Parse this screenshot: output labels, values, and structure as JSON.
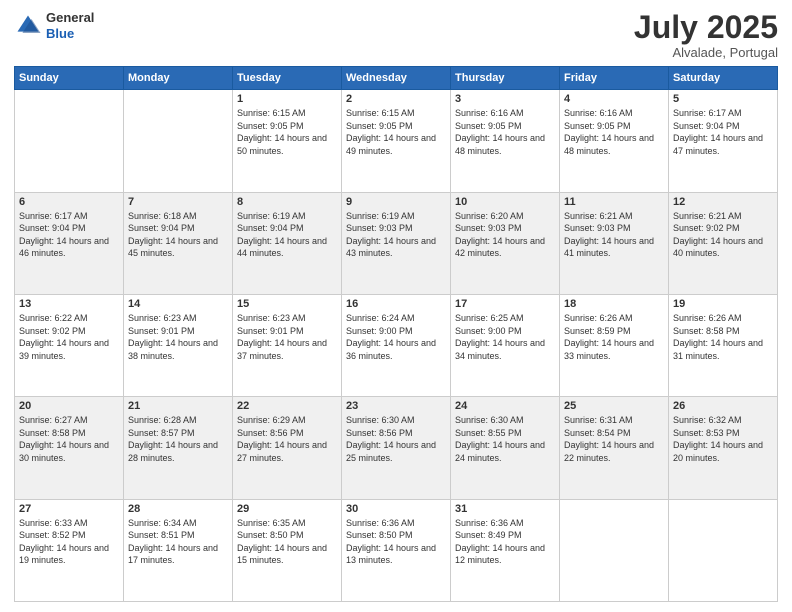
{
  "header": {
    "logo_line1": "General",
    "logo_line2": "Blue",
    "month": "July 2025",
    "location": "Alvalade, Portugal"
  },
  "weekdays": [
    "Sunday",
    "Monday",
    "Tuesday",
    "Wednesday",
    "Thursday",
    "Friday",
    "Saturday"
  ],
  "weeks": [
    [
      {
        "day": "",
        "info": ""
      },
      {
        "day": "",
        "info": ""
      },
      {
        "day": "1",
        "info": "Sunrise: 6:15 AM\nSunset: 9:05 PM\nDaylight: 14 hours and 50 minutes."
      },
      {
        "day": "2",
        "info": "Sunrise: 6:15 AM\nSunset: 9:05 PM\nDaylight: 14 hours and 49 minutes."
      },
      {
        "day": "3",
        "info": "Sunrise: 6:16 AM\nSunset: 9:05 PM\nDaylight: 14 hours and 48 minutes."
      },
      {
        "day": "4",
        "info": "Sunrise: 6:16 AM\nSunset: 9:05 PM\nDaylight: 14 hours and 48 minutes."
      },
      {
        "day": "5",
        "info": "Sunrise: 6:17 AM\nSunset: 9:04 PM\nDaylight: 14 hours and 47 minutes."
      }
    ],
    [
      {
        "day": "6",
        "info": "Sunrise: 6:17 AM\nSunset: 9:04 PM\nDaylight: 14 hours and 46 minutes."
      },
      {
        "day": "7",
        "info": "Sunrise: 6:18 AM\nSunset: 9:04 PM\nDaylight: 14 hours and 45 minutes."
      },
      {
        "day": "8",
        "info": "Sunrise: 6:19 AM\nSunset: 9:04 PM\nDaylight: 14 hours and 44 minutes."
      },
      {
        "day": "9",
        "info": "Sunrise: 6:19 AM\nSunset: 9:03 PM\nDaylight: 14 hours and 43 minutes."
      },
      {
        "day": "10",
        "info": "Sunrise: 6:20 AM\nSunset: 9:03 PM\nDaylight: 14 hours and 42 minutes."
      },
      {
        "day": "11",
        "info": "Sunrise: 6:21 AM\nSunset: 9:03 PM\nDaylight: 14 hours and 41 minutes."
      },
      {
        "day": "12",
        "info": "Sunrise: 6:21 AM\nSunset: 9:02 PM\nDaylight: 14 hours and 40 minutes."
      }
    ],
    [
      {
        "day": "13",
        "info": "Sunrise: 6:22 AM\nSunset: 9:02 PM\nDaylight: 14 hours and 39 minutes."
      },
      {
        "day": "14",
        "info": "Sunrise: 6:23 AM\nSunset: 9:01 PM\nDaylight: 14 hours and 38 minutes."
      },
      {
        "day": "15",
        "info": "Sunrise: 6:23 AM\nSunset: 9:01 PM\nDaylight: 14 hours and 37 minutes."
      },
      {
        "day": "16",
        "info": "Sunrise: 6:24 AM\nSunset: 9:00 PM\nDaylight: 14 hours and 36 minutes."
      },
      {
        "day": "17",
        "info": "Sunrise: 6:25 AM\nSunset: 9:00 PM\nDaylight: 14 hours and 34 minutes."
      },
      {
        "day": "18",
        "info": "Sunrise: 6:26 AM\nSunset: 8:59 PM\nDaylight: 14 hours and 33 minutes."
      },
      {
        "day": "19",
        "info": "Sunrise: 6:26 AM\nSunset: 8:58 PM\nDaylight: 14 hours and 31 minutes."
      }
    ],
    [
      {
        "day": "20",
        "info": "Sunrise: 6:27 AM\nSunset: 8:58 PM\nDaylight: 14 hours and 30 minutes."
      },
      {
        "day": "21",
        "info": "Sunrise: 6:28 AM\nSunset: 8:57 PM\nDaylight: 14 hours and 28 minutes."
      },
      {
        "day": "22",
        "info": "Sunrise: 6:29 AM\nSunset: 8:56 PM\nDaylight: 14 hours and 27 minutes."
      },
      {
        "day": "23",
        "info": "Sunrise: 6:30 AM\nSunset: 8:56 PM\nDaylight: 14 hours and 25 minutes."
      },
      {
        "day": "24",
        "info": "Sunrise: 6:30 AM\nSunset: 8:55 PM\nDaylight: 14 hours and 24 minutes."
      },
      {
        "day": "25",
        "info": "Sunrise: 6:31 AM\nSunset: 8:54 PM\nDaylight: 14 hours and 22 minutes."
      },
      {
        "day": "26",
        "info": "Sunrise: 6:32 AM\nSunset: 8:53 PM\nDaylight: 14 hours and 20 minutes."
      }
    ],
    [
      {
        "day": "27",
        "info": "Sunrise: 6:33 AM\nSunset: 8:52 PM\nDaylight: 14 hours and 19 minutes."
      },
      {
        "day": "28",
        "info": "Sunrise: 6:34 AM\nSunset: 8:51 PM\nDaylight: 14 hours and 17 minutes."
      },
      {
        "day": "29",
        "info": "Sunrise: 6:35 AM\nSunset: 8:50 PM\nDaylight: 14 hours and 15 minutes."
      },
      {
        "day": "30",
        "info": "Sunrise: 6:36 AM\nSunset: 8:50 PM\nDaylight: 14 hours and 13 minutes."
      },
      {
        "day": "31",
        "info": "Sunrise: 6:36 AM\nSunset: 8:49 PM\nDaylight: 14 hours and 12 minutes."
      },
      {
        "day": "",
        "info": ""
      },
      {
        "day": "",
        "info": ""
      }
    ]
  ]
}
